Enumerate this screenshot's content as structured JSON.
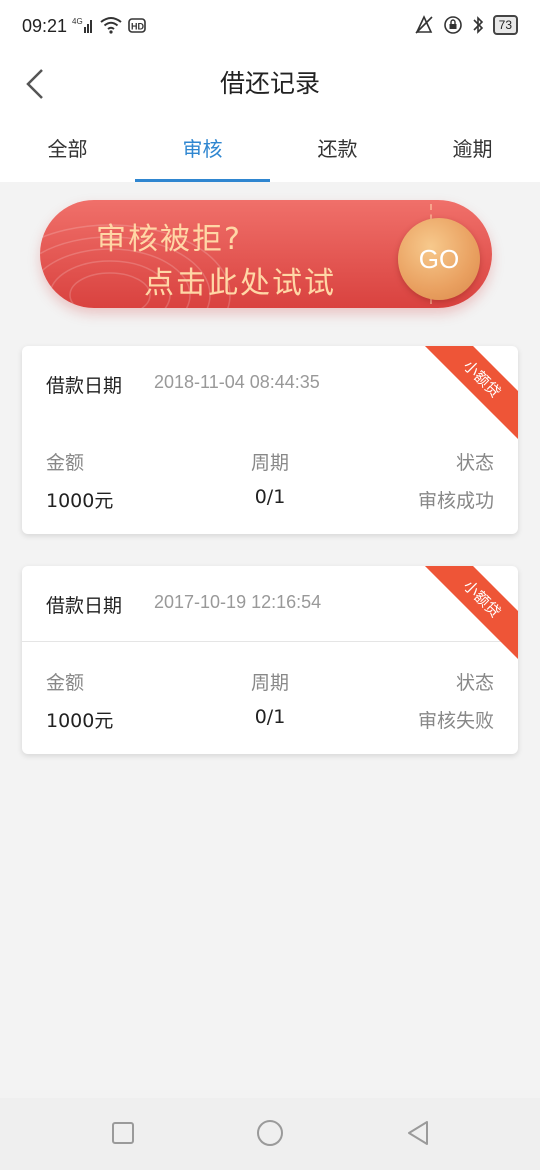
{
  "status_bar": {
    "time": "09:21",
    "icons_left": [
      "signal-4g-icon",
      "wifi-icon",
      "hd-icon"
    ],
    "icons_right": [
      "vibrate-icon",
      "lock-rotation-icon",
      "bluetooth-icon"
    ],
    "battery": "73"
  },
  "header": {
    "title": "借还记录"
  },
  "tabs": [
    {
      "label": "全部",
      "active": false
    },
    {
      "label": "审核",
      "active": true
    },
    {
      "label": "还款",
      "active": false
    },
    {
      "label": "逾期",
      "active": false
    }
  ],
  "banner": {
    "line1": "审核被拒?",
    "line2": "点击此处试试",
    "button": "GO"
  },
  "records": [
    {
      "date_label": "借款日期",
      "date": "2018-11-04 08:44:35",
      "tag": "小额贷",
      "amount_label": "金额",
      "amount": "1000元",
      "period_label": "周期",
      "period": "0/1",
      "status_label": "状态",
      "status": "审核成功"
    },
    {
      "date_label": "借款日期",
      "date": "2017-10-19 12:16:54",
      "tag": "小额贷",
      "amount_label": "金额",
      "amount": "1000元",
      "period_label": "周期",
      "period": "0/1",
      "status_label": "状态",
      "status": "审核失败"
    }
  ],
  "colors": {
    "accent": "#2f86d0",
    "banner_red": "#e0504b",
    "ribbon": "#ee5537"
  }
}
